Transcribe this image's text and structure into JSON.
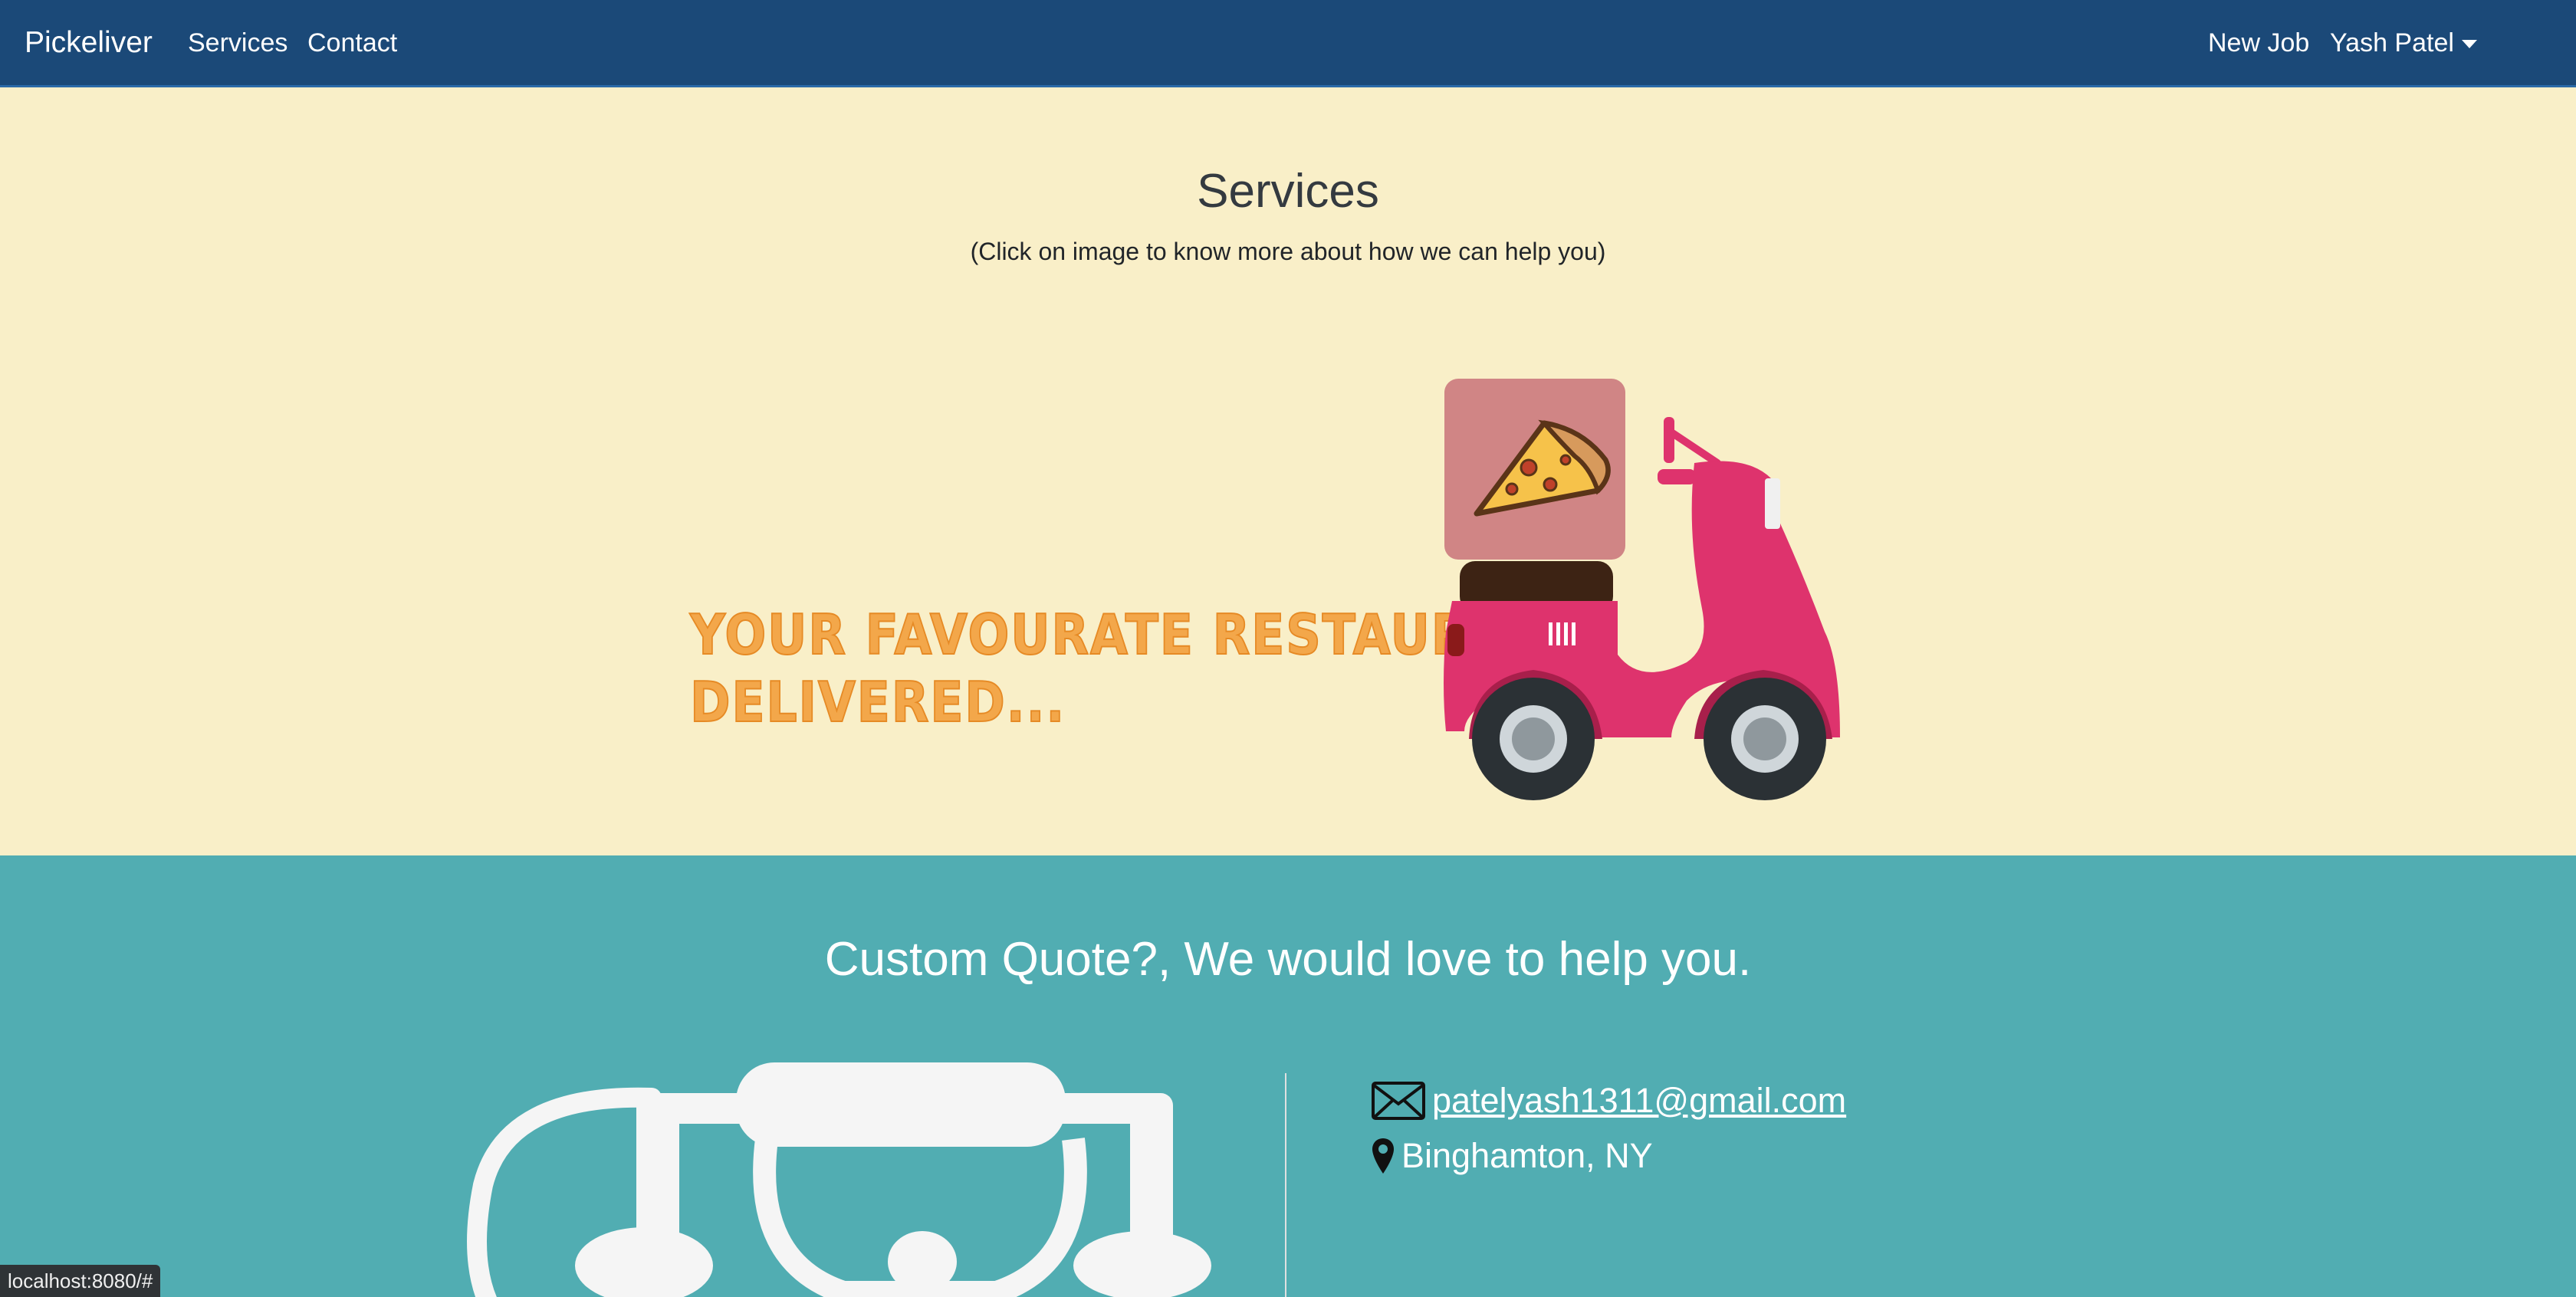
{
  "navbar": {
    "brand": "Pickeliver",
    "links": {
      "services": "Services",
      "contact": "Contact"
    },
    "new_job": "New Job",
    "user_menu": "Yash Patel"
  },
  "services": {
    "title": "Services",
    "subtitle": "(Click on image to know more about how we can help you)",
    "banner": {
      "tagline_line1": "YOUR FAVOURATE RESTAURANTS",
      "tagline_line2": "DELIVERED..."
    }
  },
  "contact": {
    "title": "Custom Quote?, We would love to help you.",
    "email": "patelyash1311@gmail.com",
    "location": "Binghamton, NY"
  },
  "status_bar": {
    "url": "localhost:8080/#"
  },
  "colors": {
    "navbar": "#1b4978",
    "services_bg": "#f9efc8",
    "contact_bg": "#51adb2",
    "tagline": "#f3a74a",
    "scooter_body": "#de336d"
  },
  "icons": {
    "email": "envelope-icon",
    "location": "map-pin-icon",
    "user_caret": "caret-down-icon"
  }
}
